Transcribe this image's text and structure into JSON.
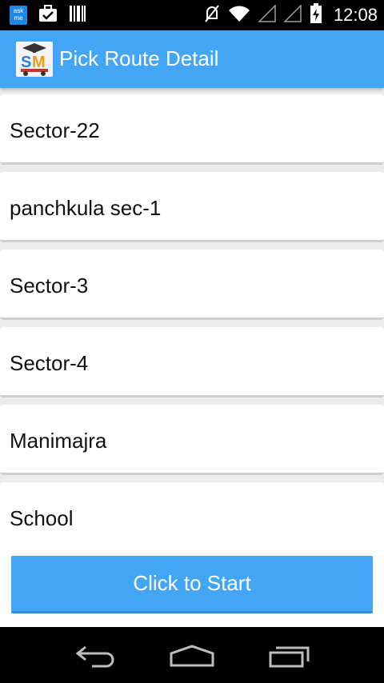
{
  "status_bar": {
    "time": "12:08",
    "notification_icons": [
      "askme-icon",
      "briefcase-check-icon",
      "barcode-icon"
    ],
    "system_icons": [
      "mute-icon",
      "wifi-icon",
      "signal-icon",
      "signal-icon",
      "battery-charging-icon"
    ],
    "askme_text": "ask me"
  },
  "action_bar": {
    "title": "Pick Route Detail",
    "logo_text": "SM"
  },
  "routes": [
    {
      "label": "Sector-22"
    },
    {
      "label": "panchkula sec-1"
    },
    {
      "label": "Sector-3"
    },
    {
      "label": "Sector-4"
    },
    {
      "label": "Manimajra"
    },
    {
      "label": "School"
    }
  ],
  "start_button": {
    "label": "Click to Start"
  },
  "nav_bar": {
    "buttons": [
      "back-icon",
      "home-icon",
      "recent-apps-icon"
    ]
  },
  "colors": {
    "accent": "#42a5f5",
    "status_bar": "#000000",
    "list_bg": "#ffffff"
  }
}
